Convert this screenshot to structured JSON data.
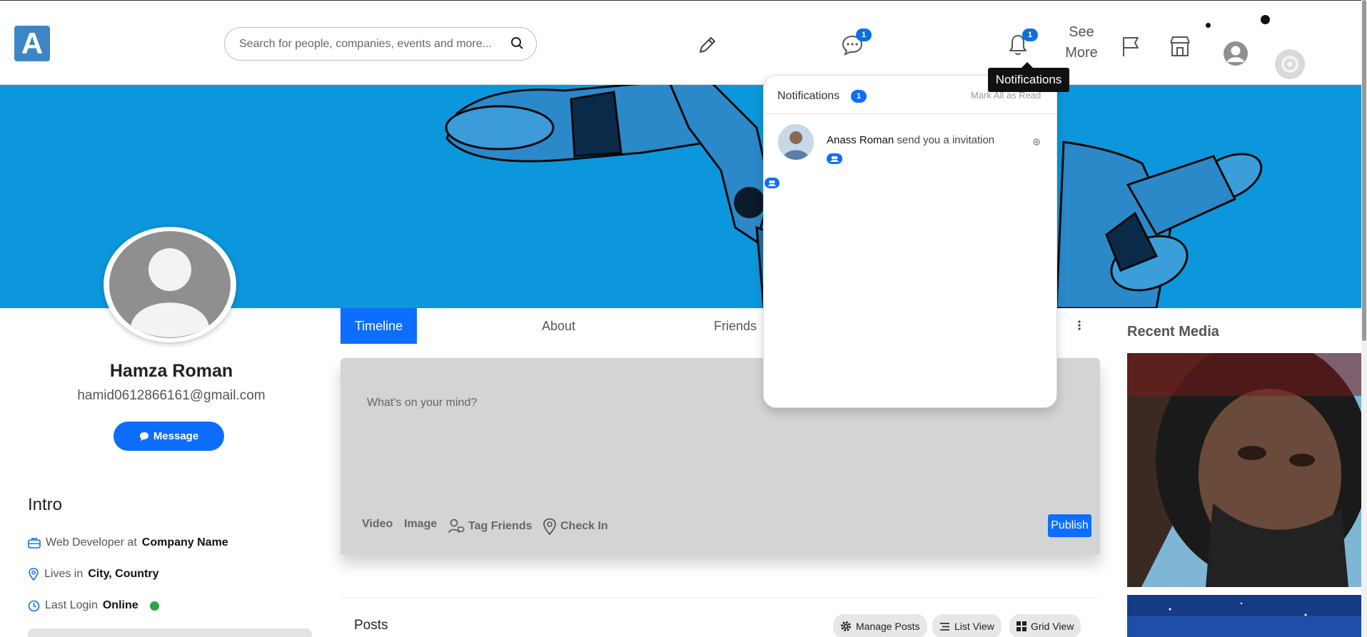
{
  "header": {
    "logo_letter": "A",
    "search": {
      "placeholder": "Search for people, companies, events and more..."
    },
    "messages_badge": "1",
    "notifications_badge": "1",
    "see_more": "See More",
    "tooltip": "Notifications"
  },
  "notifications": {
    "title": "Notifications",
    "count": "1",
    "mark_all": "Mark All as Read",
    "items": [
      {
        "name": "Anass Roman",
        "text": "send you a invitation"
      }
    ]
  },
  "profile": {
    "name": "Hamza Roman",
    "email": "hamid0612866161@gmail.com",
    "message_button": "Message"
  },
  "intro": {
    "title": "Intro",
    "job": {
      "prefix": "Web Developer at",
      "value": "Company Name"
    },
    "lives": {
      "prefix": "Lives in",
      "value": "City, Country"
    },
    "login": {
      "prefix": "Last Login",
      "value": "Online"
    }
  },
  "tabs": [
    "Timeline",
    "About",
    "Friends"
  ],
  "composer": {
    "placeholder": "What's on your mind?",
    "actions": [
      "Video",
      "Image",
      "Tag Friends",
      "Check In"
    ],
    "publish": "Publish"
  },
  "posts": {
    "title": "Posts",
    "manage": "Manage Posts",
    "list_view": "List View",
    "grid_view": "Grid View"
  },
  "recent_media": {
    "title": "Recent Media"
  },
  "colors": {
    "primary": "#0d6efd",
    "cover": "#0c97dd",
    "online": "#28a745"
  }
}
